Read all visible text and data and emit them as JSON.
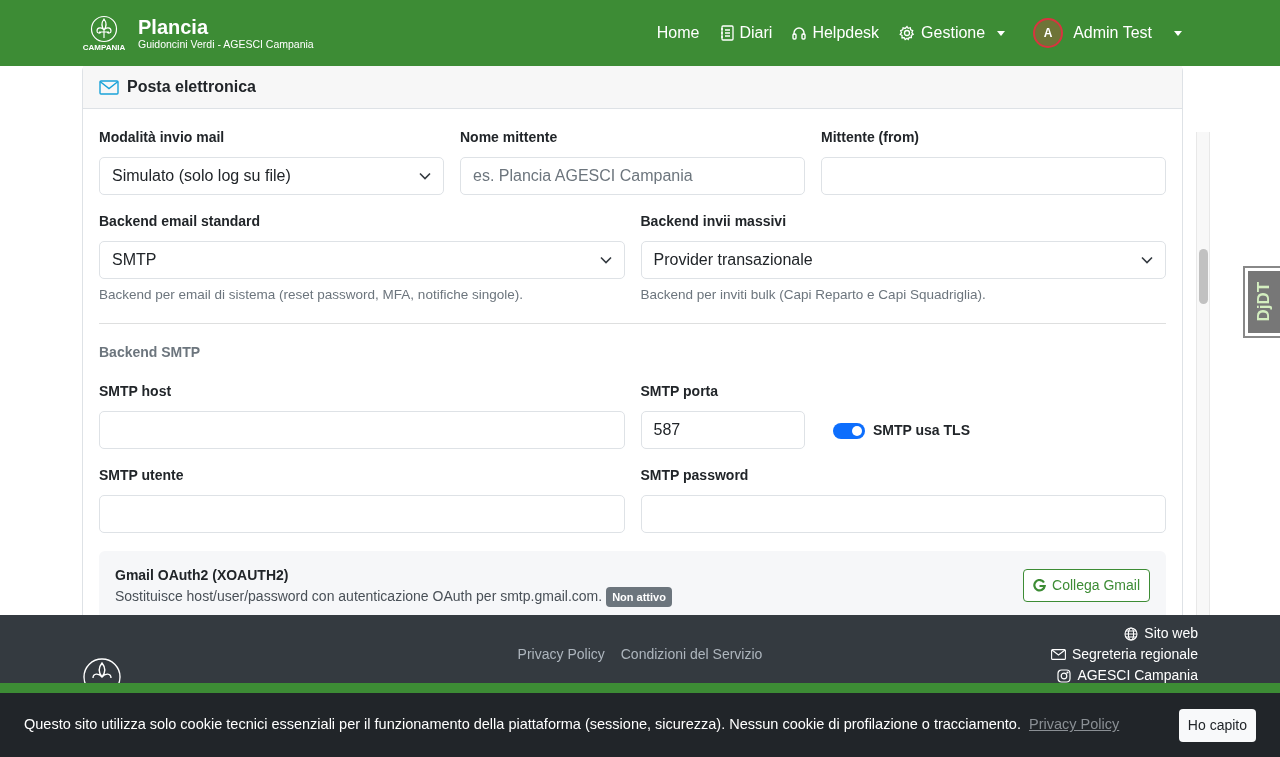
{
  "navbar": {
    "logo_caption": "CAMPANIA",
    "brand": "Plancia",
    "subtitle": "Guidoncini Verdi - AGESCI Campania",
    "links": [
      {
        "label": "Home",
        "dropdown": false
      },
      {
        "label": "Diari",
        "dropdown": false
      },
      {
        "label": "Helpdesk",
        "dropdown": false
      },
      {
        "label": "Gestione",
        "dropdown": true
      }
    ],
    "user": {
      "initial": "A",
      "name": "Admin Test",
      "dropdown": true
    }
  },
  "card": {
    "title": "Posta elettronica",
    "rows": [
      [
        {
          "kind": "select",
          "label": "Modalità invio mail",
          "value": "Simulato (solo log su file)"
        },
        {
          "kind": "text",
          "label": "Nome mittente",
          "placeholder": "es. Plancia AGESCI Campania"
        },
        {
          "kind": "text",
          "label": "Mittente (from)"
        }
      ],
      [
        {
          "kind": "select",
          "label": "Backend email standard",
          "value": "SMTP",
          "help": "Backend per email di sistema (reset password, MFA, notifiche singole)."
        },
        {
          "kind": "select",
          "label": "Backend invii massivi",
          "value": "Provider transazionale",
          "help": "Backend per inviti bulk (Capi Reparto e Capi Squadriglia)."
        }
      ]
    ],
    "section": "Backend SMTP",
    "smtp_rows": [
      [
        {
          "kind": "text",
          "label": "SMTP host"
        },
        {
          "kind": "text",
          "label": "SMTP porta",
          "value": "587"
        },
        {
          "kind": "switch",
          "label": "SMTP usa TLS",
          "on": true
        }
      ],
      [
        {
          "kind": "text",
          "label": "SMTP utente"
        },
        {
          "kind": "password",
          "label": "SMTP password"
        }
      ]
    ],
    "gmail": {
      "title": "Gmail OAuth2 (XOAUTH2)",
      "description": "Sostituisce host/user/password con autenticazione OAuth per smtp.gmail.com.",
      "badge": "Non attivo",
      "button": "Collega Gmail"
    }
  },
  "footer": {
    "links": [
      "Privacy Policy",
      "Condizioni del Servizio"
    ],
    "contacts": [
      "Sito web",
      "Segreteria regionale",
      "AGESCI Campania"
    ]
  },
  "cookie_banner": {
    "text": "Questo sito utilizza solo cookie tecnici essenziali per il funzionamento della piattaforma (sessione, sicurezza). Nessun cookie di profilazione o tracciamento.",
    "link": "Privacy Policy",
    "button": "Ho capito"
  },
  "debug_toolbar": {
    "label": "DjDT"
  }
}
